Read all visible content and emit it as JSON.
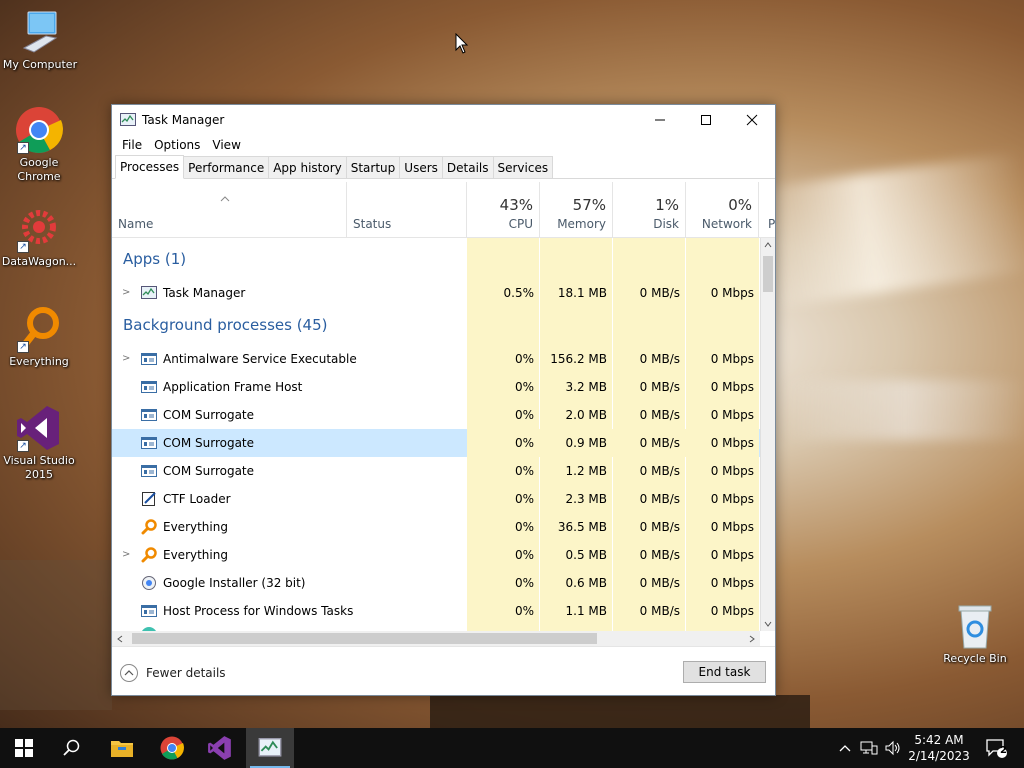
{
  "desktop": {
    "icons": [
      {
        "label": "My Computer"
      },
      {
        "label": "Google Chrome"
      },
      {
        "label": "DataWagon..."
      },
      {
        "label": "Everything"
      },
      {
        "label": "Visual Studio 2015"
      },
      {
        "label": "Recycle Bin"
      }
    ]
  },
  "window": {
    "title": "Task Manager",
    "menu": [
      "File",
      "Options",
      "View"
    ],
    "tabs": [
      "Processes",
      "Performance",
      "App history",
      "Startup",
      "Users",
      "Details",
      "Services"
    ],
    "active_tab": "Processes",
    "columns": {
      "name": "Name",
      "status": "Status",
      "cpu": {
        "pct": "43%",
        "label": "CPU"
      },
      "memory": {
        "pct": "57%",
        "label": "Memory"
      },
      "disk": {
        "pct": "1%",
        "label": "Disk"
      },
      "network": {
        "pct": "0%",
        "label": "Network"
      },
      "power_partial": "P"
    },
    "groups": {
      "apps": "Apps (1)",
      "background": "Background processes (45)"
    },
    "apps": [
      {
        "name": "Task Manager",
        "cpu": "0.5%",
        "memory": "18.1 MB",
        "disk": "0 MB/s",
        "network": "0 Mbps"
      }
    ],
    "background": [
      {
        "name": "Antimalware Service Executable",
        "cpu": "0%",
        "memory": "156.2 MB",
        "disk": "0 MB/s",
        "network": "0 Mbps"
      },
      {
        "name": "Application Frame Host",
        "cpu": "0%",
        "memory": "3.2 MB",
        "disk": "0 MB/s",
        "network": "0 Mbps"
      },
      {
        "name": "COM Surrogate",
        "cpu": "0%",
        "memory": "2.0 MB",
        "disk": "0 MB/s",
        "network": "0 Mbps"
      },
      {
        "name": "COM Surrogate",
        "cpu": "0%",
        "memory": "0.9 MB",
        "disk": "0 MB/s",
        "network": "0 Mbps"
      },
      {
        "name": "COM Surrogate",
        "cpu": "0%",
        "memory": "1.2 MB",
        "disk": "0 MB/s",
        "network": "0 Mbps"
      },
      {
        "name": "CTF Loader",
        "cpu": "0%",
        "memory": "2.3 MB",
        "disk": "0 MB/s",
        "network": "0 Mbps"
      },
      {
        "name": "Everything",
        "cpu": "0%",
        "memory": "36.5 MB",
        "disk": "0 MB/s",
        "network": "0 Mbps"
      },
      {
        "name": "Everything",
        "cpu": "0%",
        "memory": "0.5 MB",
        "disk": "0 MB/s",
        "network": "0 Mbps"
      },
      {
        "name": "Google Installer (32 bit)",
        "cpu": "0%",
        "memory": "0.6 MB",
        "disk": "0 MB/s",
        "network": "0 Mbps"
      },
      {
        "name": "Host Process for Windows Tasks",
        "cpu": "0%",
        "memory": "1.1 MB",
        "disk": "0 MB/s",
        "network": "0 Mbps"
      }
    ],
    "footer": {
      "fewer_details": "Fewer details",
      "end_task": "End task"
    }
  },
  "taskbar": {
    "clock_time": "5:42 AM",
    "clock_date": "2/14/2023",
    "notification_count": "2"
  },
  "colors": {
    "heat": "#fcf5c8",
    "selected_row": "#cce8ff",
    "group_title": "#2a5ea0",
    "taskbar": "#101010"
  }
}
